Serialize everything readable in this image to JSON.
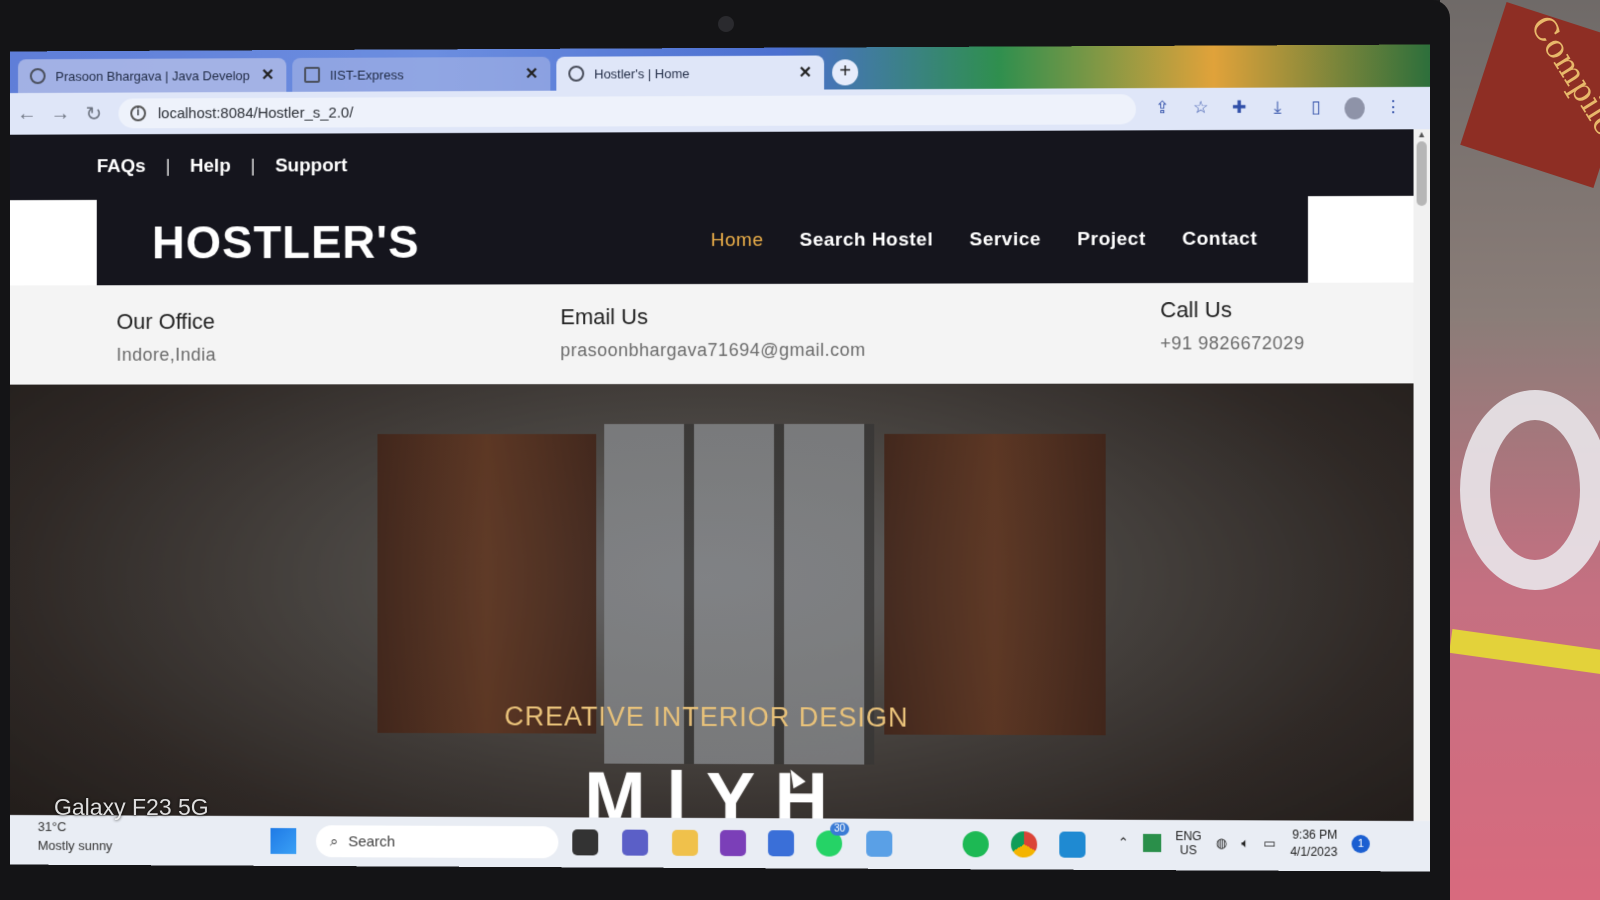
{
  "browser": {
    "tabs": [
      {
        "label": "Prasoon Bhargava | Java Develop",
        "close": "✕"
      },
      {
        "label": "IIST-Express",
        "close": "✕"
      },
      {
        "label": "Hostler's | Home",
        "close": "✕"
      }
    ],
    "new_tab": "+",
    "url": "localhost:8084/Hostler_s_2.0/"
  },
  "topbar": {
    "links": [
      "FAQs",
      "Help",
      "Support"
    ],
    "separator": "|"
  },
  "navbar": {
    "logo": "HOSTLER'S",
    "menu": [
      "Home",
      "Search Hostel",
      "Service",
      "Project",
      "Contact"
    ],
    "active": "Home"
  },
  "contact": {
    "office_label": "Our Office",
    "office_value": "Indore,India",
    "email_label": "Email Us",
    "email_value": "prasoonbhargava71694@gmail.com",
    "call_label": "Call Us",
    "call_value": "+91 9826672029"
  },
  "hero": {
    "subtitle": "CREATIVE INTERIOR DESIGN",
    "title": "M  l     Y       H"
  },
  "taskbar": {
    "weather_temp": "31°C",
    "weather_desc": "Mostly sunny",
    "search_placeholder": "Search",
    "badge": "30",
    "lang_1": "ENG",
    "lang_2": "US",
    "time": "9:36 PM",
    "date": "4/1/2023",
    "notifications": "1"
  },
  "photo": {
    "watermark": "Galaxy F23 5G",
    "book_text": "Compilers"
  },
  "colors": {
    "nav_bg": "#15151d",
    "accent": "#f0b24a",
    "hero_gold": "#e9c27a"
  }
}
